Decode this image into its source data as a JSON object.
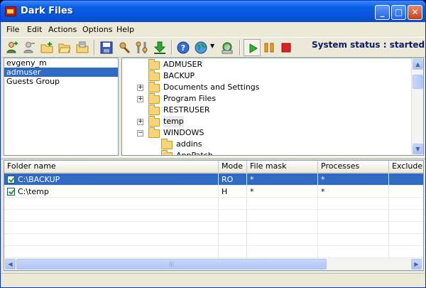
{
  "window": {
    "title": "Dark Files",
    "controls": [
      "_",
      "□",
      "✕"
    ]
  },
  "menu": [
    "File",
    "Edit",
    "Actions",
    "Options",
    "Help"
  ],
  "toolbar": {
    "icons": [
      "add-user-icon",
      "remove-user-icon",
      "add-folder-icon",
      "open-folder-icon",
      "folder-properties-icon",
      "save-icon",
      "settings-icon",
      "tools-icon",
      "download-icon",
      "help-icon",
      "globe-icon",
      "network-icon",
      "start-icon",
      "pause-icon",
      "stop-icon"
    ],
    "status": "System status : started"
  },
  "users": [
    "evgeny_m",
    "admuser",
    "Guests Group"
  ],
  "selected_user": "admuser",
  "tree": [
    {
      "label": "ADMUSER",
      "expander": ""
    },
    {
      "label": "BACKUP",
      "expander": ""
    },
    {
      "label": "Documents and Settings",
      "expander": "+"
    },
    {
      "label": "Program Files",
      "expander": "+"
    },
    {
      "label": "RESTRUSER",
      "expander": ""
    },
    {
      "label": "temp",
      "expander": "+"
    },
    {
      "label": "WINDOWS",
      "expander": "−"
    },
    {
      "label": "addins",
      "expander": ""
    },
    {
      "label": "AppPatch",
      "expander": ""
    }
  ],
  "grid": {
    "headers": [
      "Folder name",
      "Mode",
      "File mask",
      "Processes",
      "Exclude"
    ],
    "rows": [
      {
        "folder": "C:\\BACKUP",
        "mode": "RO",
        "mask": "*",
        "processes": "*",
        "exclude": "",
        "checked": true,
        "selected": true
      },
      {
        "folder": "C:\\temp",
        "mode": "H",
        "mask": "*",
        "processes": "*",
        "exclude": "",
        "checked": true,
        "selected": false
      }
    ]
  },
  "colors": {
    "accent": "#316ac5",
    "title": "#0a5ee6",
    "status": "#0a1a6a"
  }
}
